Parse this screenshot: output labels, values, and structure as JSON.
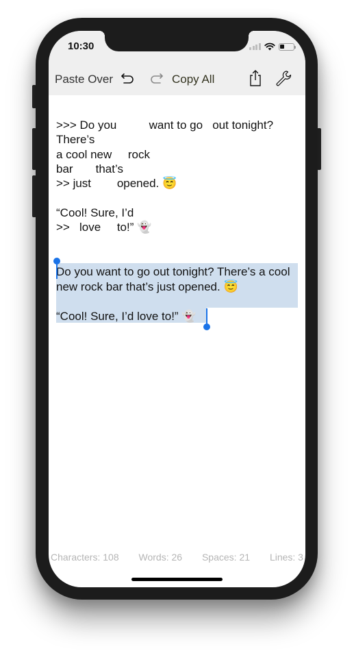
{
  "status_bar": {
    "time": "10:30",
    "icons": [
      "cellular-signal-icon",
      "wifi-icon",
      "battery-icon"
    ],
    "battery_level_percent": 35
  },
  "toolbar": {
    "paste_over_label": "Paste Over",
    "undo_icon": "undo-arrow-icon",
    "redo_icon": "redo-arrow-icon",
    "copy_all_label": "Copy All",
    "share_icon": "share-icon",
    "settings_icon": "wrench-icon"
  },
  "raw_text": {
    "lines": [
      ">>> Do you          want to go   out tonight?",
      "There’s",
      "a cool new     rock",
      "bar       that’s",
      ">> just        opened. 😇",
      "",
      "“Cool! Sure, I’d",
      ">>   love     to!” 👻"
    ]
  },
  "cleaned_text": {
    "paragraph_1": "Do you want to go out tonight? There’s a cool new rock bar that’s just opened. 😇",
    "paragraph_2": "“Cool! Sure, I’d love to!” 👻",
    "selected": true
  },
  "stats": {
    "characters": "Characters: 108",
    "words": "Words: 26",
    "spaces": "Spaces: 21",
    "lines": "Lines: 3"
  },
  "colors": {
    "toolbar_bg": "#efefef",
    "selection_highlight": "#cfdeee",
    "selection_handle": "#1a73e8",
    "stats_text": "#b5b5b5",
    "copy_all_text": "#33331f"
  }
}
